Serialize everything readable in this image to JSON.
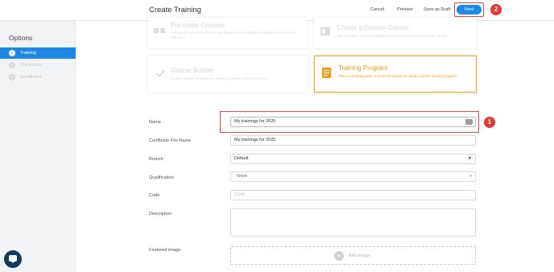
{
  "header": {
    "title": "Create Training",
    "cancel_label": "Cancel",
    "preview_label": "Preview",
    "save_draft_label": "Save as Draft",
    "next_label": "Next"
  },
  "sidebar": {
    "heading": "Options",
    "steps": [
      {
        "number": "1",
        "label": "Training",
        "active": true
      },
      {
        "number": "2",
        "label": "Curriculum",
        "active": false
      },
      {
        "number": "3",
        "label": "Enrollment",
        "active": false
      }
    ]
  },
  "cards": {
    "premade": {
      "title": "Pre-made Courses",
      "desc": "A library of courses professionally designed and templates created by LearnBeam Trainers."
    },
    "custom": {
      "title": "Create a Custom Course",
      "desc": "Use a custom training template from Course Builder to start from scratch."
    },
    "builder": {
      "title": "Course Builder",
      "desc": "Create updated and general courses professionally from scratch."
    },
    "program": {
      "title": "Training Program",
      "desc": "This is a learning path, a series of courses to create a whole training program."
    }
  },
  "form": {
    "name_label": "Name",
    "name_value": "My trainings for 2025",
    "certificate_label": "Certificate File Name",
    "certificate_value": "My trainings for 2025",
    "branch_label": "Branch",
    "branch_value": "Default",
    "qualification_label": "Qualification",
    "qualification_value": "None",
    "code_label": "Code",
    "code_placeholder": "Code",
    "description_label": "Description",
    "featured_label": "Featured image",
    "add_image_label": "Add image"
  },
  "markers": {
    "first": "1",
    "second": "2"
  },
  "colors": {
    "accent": "#1e88e5",
    "highlight": "#e04b4b",
    "selected": "#f39c12"
  }
}
